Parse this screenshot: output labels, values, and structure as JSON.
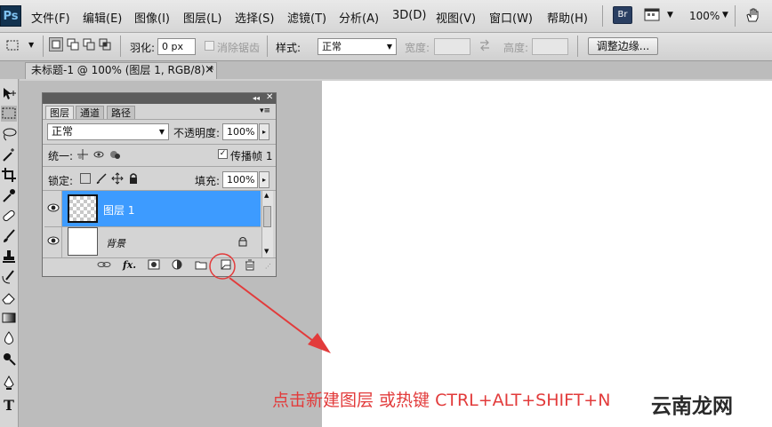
{
  "app": {
    "logo": "Ps",
    "menu": [
      "文件(F)",
      "编辑(E)",
      "图像(I)",
      "图层(L)",
      "选择(S)",
      "滤镜(T)",
      "分析(A)",
      "3D(D)",
      "视图(V)",
      "窗口(W)",
      "帮助(H)"
    ],
    "bridge_button": "Br",
    "zoom": "100%"
  },
  "options_bar": {
    "feather_label": "羽化:",
    "feather_value": "0 px",
    "antialias_label": "消除锯齿",
    "style_label": "样式:",
    "style_value": "正常",
    "width_label": "宽度:",
    "height_label": "高度:",
    "refine_edge_button": "调整边缘..."
  },
  "document": {
    "tab_title": "未标题-1 @ 100% (图层 1, RGB/8) *",
    "close": "×"
  },
  "layers_panel": {
    "tabs": [
      "图层",
      "通道",
      "路径"
    ],
    "blend_mode": "正常",
    "opacity_label": "不透明度:",
    "opacity_value": "100%",
    "unify_label": "统一:",
    "propagate_label": "传播帧 1",
    "lock_label": "锁定:",
    "fill_label": "填充:",
    "fill_value": "100%",
    "layers": [
      {
        "name": "图层 1",
        "selected": true
      },
      {
        "name": "背景",
        "selected": false
      }
    ]
  },
  "annotation": {
    "text": "点击新建图层 或热键 CTRL+ALT+SHIFT+N",
    "color": "#e23b3b"
  },
  "watermark": "云南龙网",
  "colors": {
    "selection_blue": "#3d9bff",
    "menu_bg": "#dcdcdc"
  }
}
